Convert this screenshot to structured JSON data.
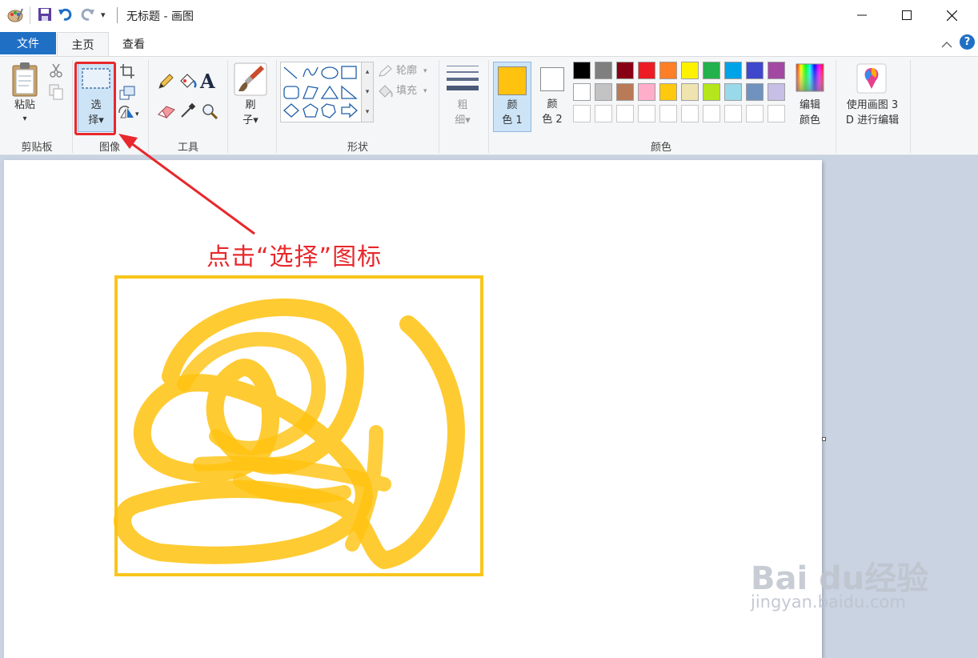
{
  "window": {
    "title": "无标题 - 画图",
    "qa_dropdown": "▾"
  },
  "tabs": [
    {
      "label": "文件"
    },
    {
      "label": "主页"
    },
    {
      "label": "查看"
    }
  ],
  "help_label": "?",
  "ribbon": {
    "clipboard": {
      "paste_label": "粘贴",
      "group_label": "剪贴板"
    },
    "image": {
      "select_line1": "选",
      "select_line2": "择▾",
      "group_label": "图像"
    },
    "tools": {
      "group_label": "工具",
      "text_tool": "A"
    },
    "brush": {
      "line1": "刷",
      "line2": "子▾"
    },
    "shapes": {
      "outline_label": "轮廓",
      "fill_label": "填充",
      "group_label": "形状"
    },
    "size": {
      "line1": "粗",
      "line2": "细▾"
    },
    "colors": {
      "color1_line1": "颜",
      "color1_line2": "色 1",
      "color2_line1": "颜",
      "color2_line2": "色 2",
      "color1_value": "#ffc20e",
      "color2_value": "#ffffff",
      "edit_line1": "编辑",
      "edit_line2": "颜色",
      "group_label": "颜色",
      "palette_row1": [
        "#000000",
        "#7f7f7f",
        "#880015",
        "#ed1c24",
        "#ff7f27",
        "#fff200",
        "#22b14c",
        "#00a2e8",
        "#3f48cc",
        "#a349a4"
      ],
      "palette_row2": [
        "#ffffff",
        "#c3c3c3",
        "#b97a57",
        "#ffaec9",
        "#ffc90e",
        "#efe4b0",
        "#b5e61d",
        "#99d9ea",
        "#7092be",
        "#c8bfe7"
      ]
    },
    "paint3d": {
      "line1": "使用画图 3",
      "line2": "D 进行编辑"
    }
  },
  "annotation": {
    "text": "点击“选择”图标",
    "color": "#e8282c"
  },
  "drawing": {
    "stroke_color": "#ffc20e",
    "frame_color": "#f8c51c"
  },
  "watermark": {
    "brand": "Bai du经验",
    "url": "jingyan.baidu.com"
  }
}
